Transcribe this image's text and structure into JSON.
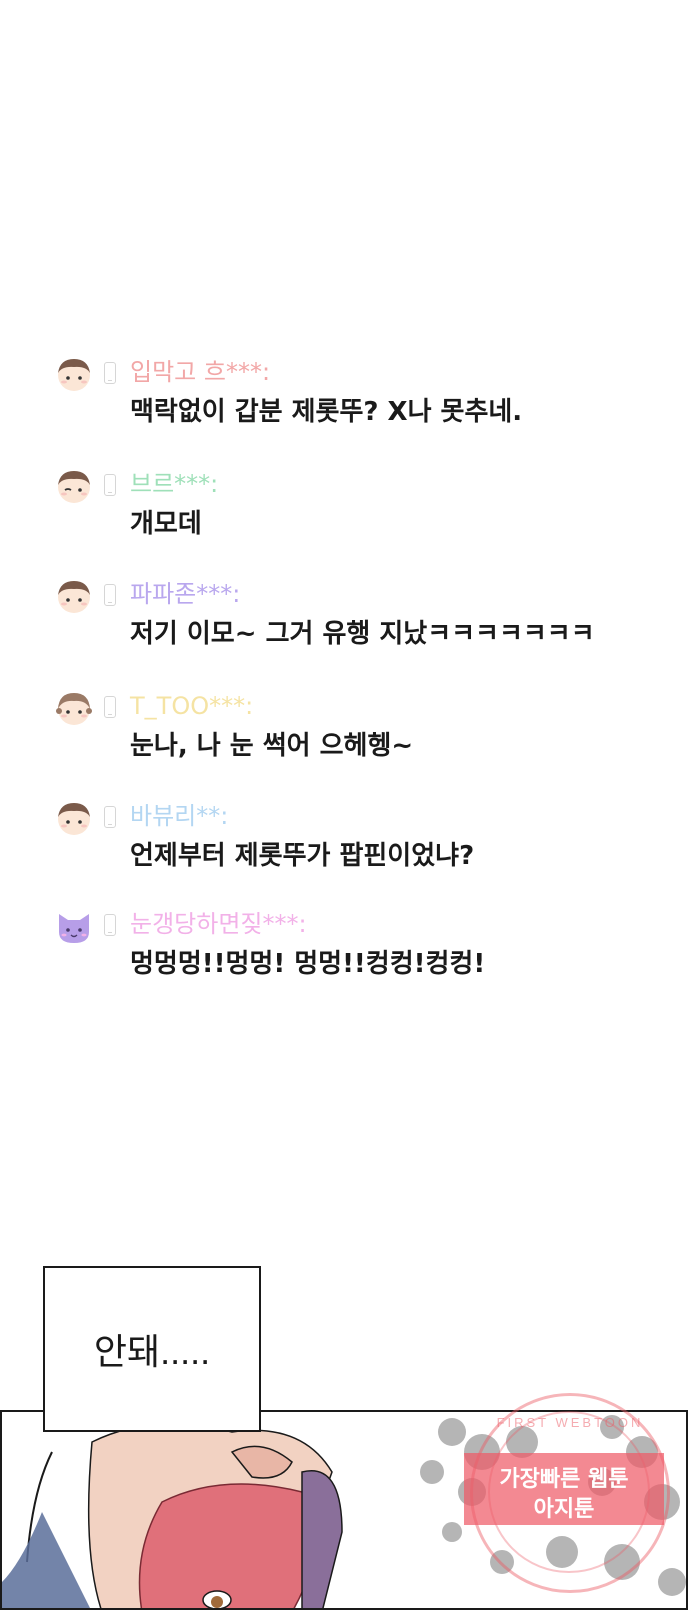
{
  "comments": [
    {
      "nickname": "입막고 흐***:",
      "message": "맥락없이 갑분 제롯뚜? X나 못추네.",
      "nick_color": "#f2a7a7",
      "avatar": "boy-face-icon"
    },
    {
      "nickname": "브르***:",
      "message": "개모데",
      "nick_color": "#9fe0b9",
      "avatar": "winking-boy-face-icon"
    },
    {
      "nickname": "파파존***:",
      "message": "저기 이모~ 그거 유행 지났ㅋㅋㅋㅋㅋㅋㅋ",
      "nick_color": "#b9a7ee",
      "avatar": "boy-face-icon"
    },
    {
      "nickname": "T_TOO***:",
      "message": "눈나, 나 눈 썩어 으헤헹~",
      "nick_color": "#f5e3a3",
      "avatar": "girl-face-icon"
    },
    {
      "nickname": "바뷰리**:",
      "message": "언제부터 제롯뚜가 팝핀이었냐?",
      "nick_color": "#b3d6f2",
      "avatar": "boy-face-icon"
    },
    {
      "nickname": "눈갱당하면짖***:",
      "message": "멍멍멍!!멍멍! 멍멍!!컹컹!컹컹!",
      "nick_color": "#f2b1e8",
      "avatar": "purple-cat-icon"
    }
  ],
  "speech_bubble": {
    "text": "안돼....."
  },
  "watermark": {
    "top_text": "FIRST WEBTOON",
    "line1": "가장빠른 웹툰",
    "line2": "아지툰"
  },
  "colors": {
    "hair": "#7a5a4a",
    "skin": "#fbe6d6",
    "cat": "#b79ee8",
    "panel_hair": "#e0707a",
    "watermark": "#ee5c68"
  }
}
